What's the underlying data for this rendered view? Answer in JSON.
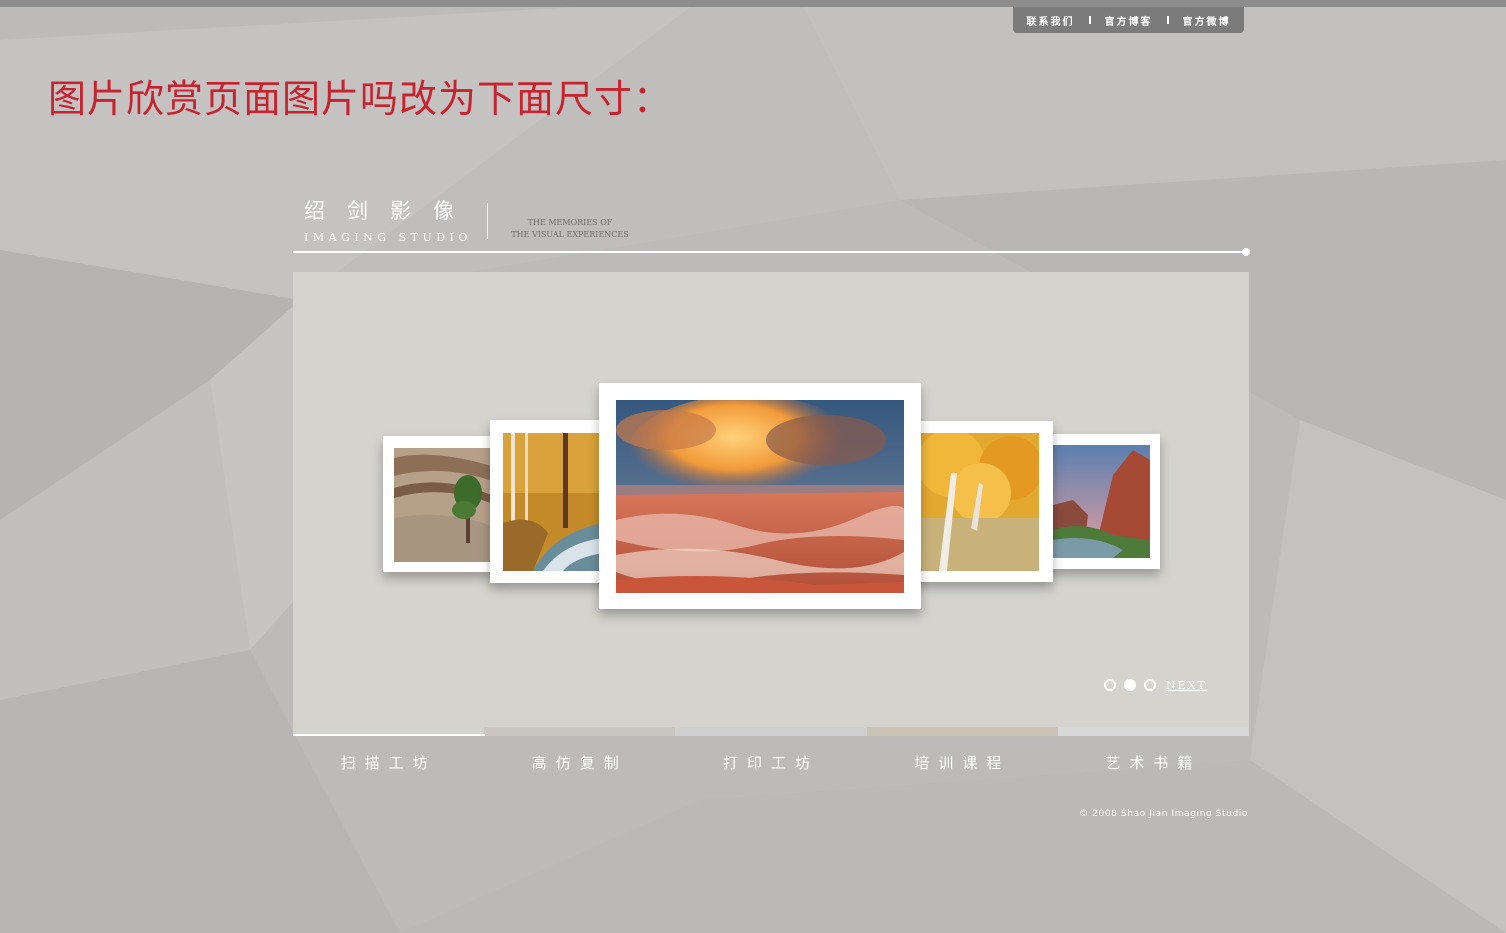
{
  "top_links": [
    "联系我们",
    "官方博客",
    "官方微博"
  ],
  "note": "图片欣赏页面图片吗改为下面尺寸：",
  "brand": {
    "cn": "绍剑影像",
    "en": "IMAGING STUDIO",
    "tagline_1": "THE MEMORIES OF",
    "tagline_2": "THE VISUAL EXPERIENCES"
  },
  "gallery": {
    "photos": [
      {
        "subject": "rock-and-tree"
      },
      {
        "subject": "autumn-stream"
      },
      {
        "subject": "canyon-storm",
        "featured": true
      },
      {
        "subject": "golden-birch"
      },
      {
        "subject": "red-canyon-river"
      }
    ],
    "pager": {
      "dots": 3,
      "active": 2,
      "next_label": "NEXT"
    }
  },
  "nav": {
    "items": [
      "扫描工坊",
      "高仿复制",
      "打印工坊",
      "培训课程",
      "艺术书籍"
    ],
    "active": 0,
    "bar_colors": [
      "#d4d3ce",
      "#c9c6c0",
      "#cfcfcf",
      "#cbc3b6",
      "#d8d8d8"
    ]
  },
  "copyright": "© 2008 Shao Jian Imaging Studio",
  "colors": {
    "accent_text": "#c8222f",
    "background": "#bdbcba",
    "stage": "#d4d3ce"
  }
}
